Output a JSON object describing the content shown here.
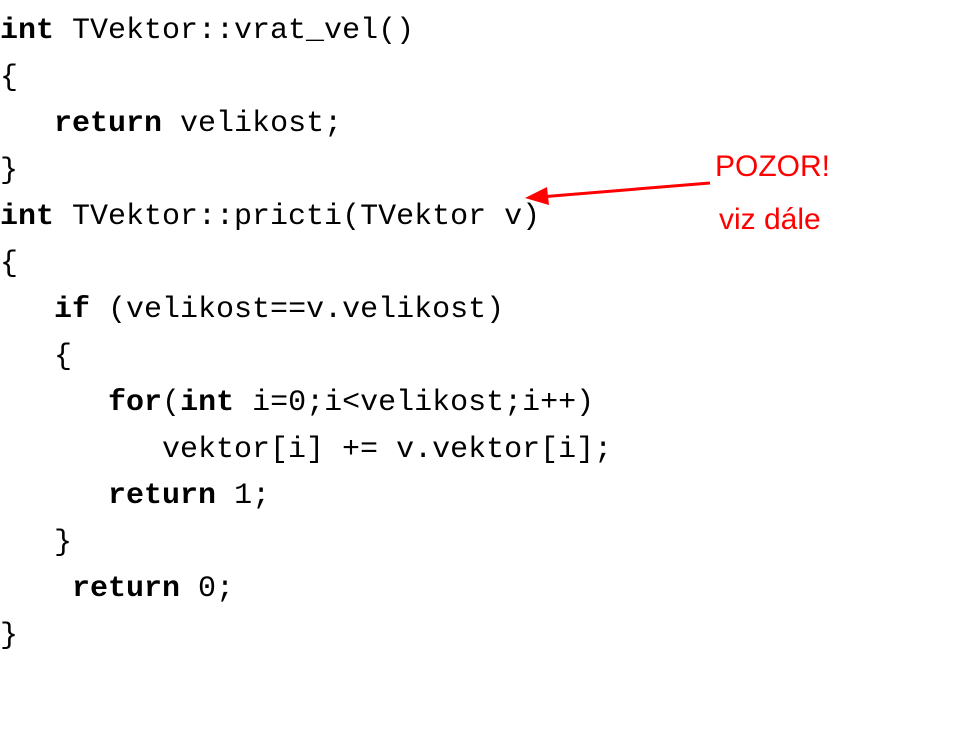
{
  "code": {
    "l1_kw": "int",
    "l1_rest": " TVektor::vrat_vel()",
    "l2": "{",
    "l3_pad": "   ",
    "l3_kw": "return",
    "l3_rest": " velikost;",
    "l4": "}",
    "l5_kw": "int",
    "l5_rest": " TVektor::pricti(TVektor v)",
    "l6": "{",
    "l7_pad": "   ",
    "l7_kw": "if",
    "l7_rest": " (velikost==v.velikost)",
    "l8": "   {",
    "l9_pad": "      ",
    "l9_kw": "for",
    "l9_rest": "(",
    "l9_kw2": "int",
    "l9_rest2": " i=0;i<velikost;i++)",
    "l10": "         vektor[i] += v.vektor[i];",
    "l11_pad": "      ",
    "l11_kw": "return",
    "l11_rest": " 1;",
    "l12": "   }",
    "l13_pad": "    ",
    "l13_kw": "return",
    "l13_rest": " 0;",
    "l14": "}"
  },
  "annotation": {
    "line1": "POZOR!",
    "line2": "viz dále"
  },
  "colors": {
    "accent": "#ff0000"
  }
}
